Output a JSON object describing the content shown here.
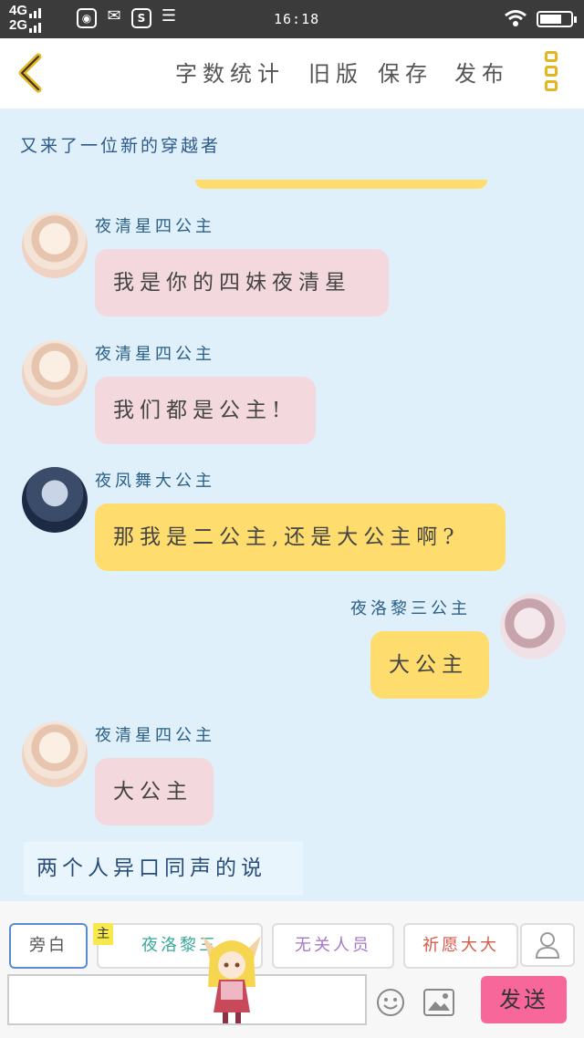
{
  "status_bar": {
    "network_1": "4G",
    "network_2": "2G",
    "time": "16:18",
    "battery_level": 0.72
  },
  "header": {
    "buttons": [
      "字数统计",
      "旧版",
      "保存",
      "发布"
    ]
  },
  "chat": {
    "narration_top": "又来了一位新的穿越者",
    "messages": [
      {
        "sender": "夜清星四公主",
        "text": "我是你的四妹夜清星"
      },
      {
        "sender": "夜清星四公主",
        "text": "我们都是公主!"
      },
      {
        "sender": "夜凤舞大公主",
        "text": "那我是二公主,还是大公主啊?"
      },
      {
        "sender": "夜洛黎三公主",
        "text": "大公主"
      },
      {
        "sender": "夜清星四公主",
        "text": "大公主"
      }
    ],
    "narration_bottom": "两个人异口同声的说"
  },
  "bottom_bar": {
    "roles": [
      "旁白",
      "夜洛黎三",
      "无关人员",
      "祈愿大大"
    ],
    "protagonist_tag": "主",
    "input_value": "",
    "send_label": "发送"
  },
  "colors": {
    "chat_bg": "#dff0fb",
    "pink_bubble": "#f3d9de",
    "yellow_bubble": "#fedc6d",
    "send_button": "#f7679a",
    "menu_accent": "#e3b61f"
  }
}
